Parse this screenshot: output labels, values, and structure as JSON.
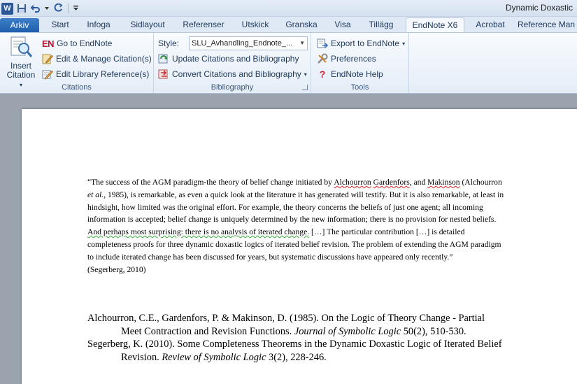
{
  "titlebar": {
    "doc_title": "Dynamic Doxastic",
    "app_icon_letter": "W"
  },
  "tabs": {
    "file": "Arkiv",
    "items": [
      "Start",
      "Infoga",
      "Sidlayout",
      "Referenser",
      "Utskick",
      "Granska",
      "Visa",
      "Tillägg",
      "EndNote X6",
      "Acrobat",
      "Reference Man"
    ]
  },
  "ribbon": {
    "citations": {
      "insert_label_1": "Insert",
      "insert_label_2": "Citation",
      "goto": "Go to EndNote",
      "goto_prefix": "EN",
      "edit_manage": "Edit & Manage Citation(s)",
      "edit_library": "Edit Library Reference(s)",
      "group_label": "Citations"
    },
    "bibliography": {
      "style_label": "Style:",
      "style_value": "SLU_Avhandling_Endnote_...",
      "update": "Update Citations and Bibliography",
      "convert": "Convert Citations and Bibliography",
      "group_label": "Bibliography"
    },
    "tools": {
      "export": "Export to EndNote",
      "preferences": "Preferences",
      "help": "EndNote Help",
      "group_label": "Tools"
    }
  },
  "document": {
    "quote": {
      "p1": "“The success of the AGM paradigm-the theory of belief change initiated by ",
      "alch": "Alchourron",
      "p2": " ",
      "gard": "Gardenfors",
      "p3": ", and ",
      "mak": "Makinson",
      "p4": " (Alchourron ",
      "etal": "et al.",
      "p5": ", 1985), is remarkable, as even a quick look at the literature it has generated will testify. But it is also remarkable, at least in hindsight, how limited was the original effort. For example, the theory concerns the beliefs of just one agent; all incoming information is accepted; belief change is uniquely determined by the new information; there is no provision for nested beliefs. ",
      "green": "And perhaps most surprising: there is no analysis of iterated change.",
      "p6": " […] The particular contribution […] is detailed completeness proofs for three dynamic doxastic logics of iterated belief revision. The problem of extending the AGM paradigm to include iterated change has been discussed for years, but systematic discussions have appeared only recently.”",
      "cite": "(Segerberg, 2010)"
    },
    "references": [
      {
        "plain": "Alchourron, C.E., Gardenfors, P. & Makinson, D. (1985). On the Logic of Theory Change - Partial Meet Contraction and Revision Functions. ",
        "journal": "Journal of Symbolic Logic",
        "tail": " 50(2), 510-530."
      },
      {
        "plain": "Segerberg, K. (2010). Some Completeness Theorems in the Dynamic Doxastic Logic of Iterated Belief Revision. ",
        "journal": "Review of Symbolic Logic",
        "tail": " 3(2), 228-246."
      }
    ]
  }
}
